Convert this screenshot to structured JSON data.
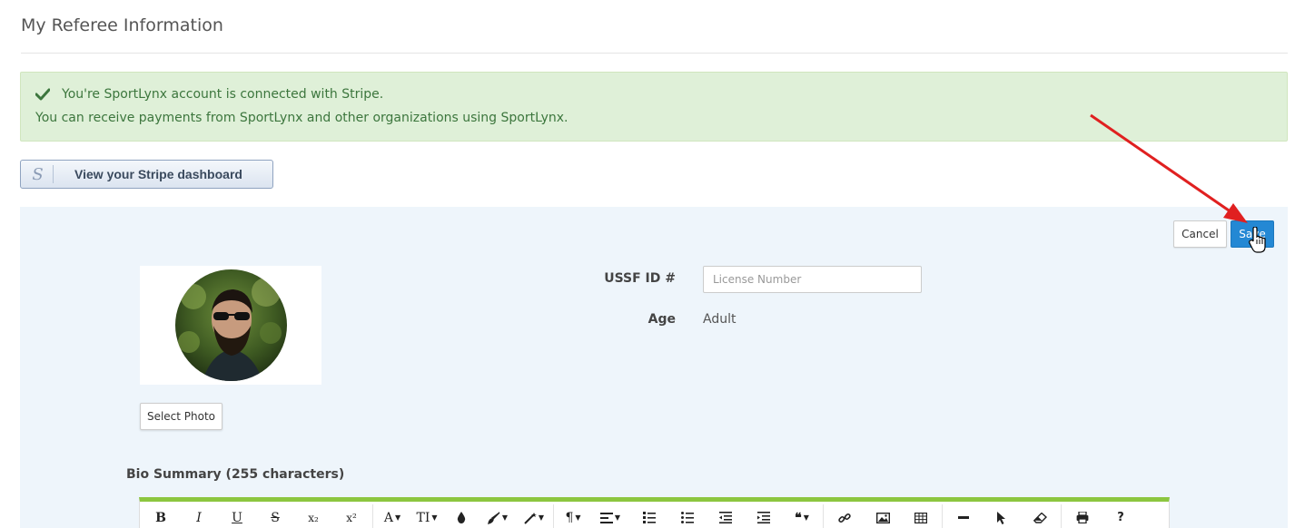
{
  "header": {
    "title": "My Referee Information"
  },
  "alert": {
    "line1": "You're SportLynx account is connected with Stripe.",
    "line2": "You can receive payments from SportLynx and other organizations using SportLynx.",
    "color": "#3c763d",
    "background": "#dff0d8"
  },
  "stripe": {
    "icon_glyph": "S",
    "button_label": "View your Stripe dashboard"
  },
  "actions": {
    "cancel_label": "Cancel",
    "save_label": "Save",
    "save_color": "#2488d4"
  },
  "photo": {
    "select_label": "Select Photo"
  },
  "form": {
    "ussf_label": "USSF ID #",
    "license_placeholder": "License Number",
    "license_value": "",
    "age_label": "Age",
    "age_value": "Adult"
  },
  "bio": {
    "label": "Bio Summary (255 characters)",
    "accent_color": "#8cc63f"
  },
  "toolbar": {
    "bold": "B",
    "italic": "I",
    "underline": "U",
    "strikethrough": "S",
    "subscript": "x₂",
    "superscript": "x²",
    "font_family": "A",
    "font_size": "TI",
    "paragraph": "¶",
    "quote": "❝",
    "help": "?"
  },
  "annotation": {
    "arrow_color": "#e02020"
  }
}
